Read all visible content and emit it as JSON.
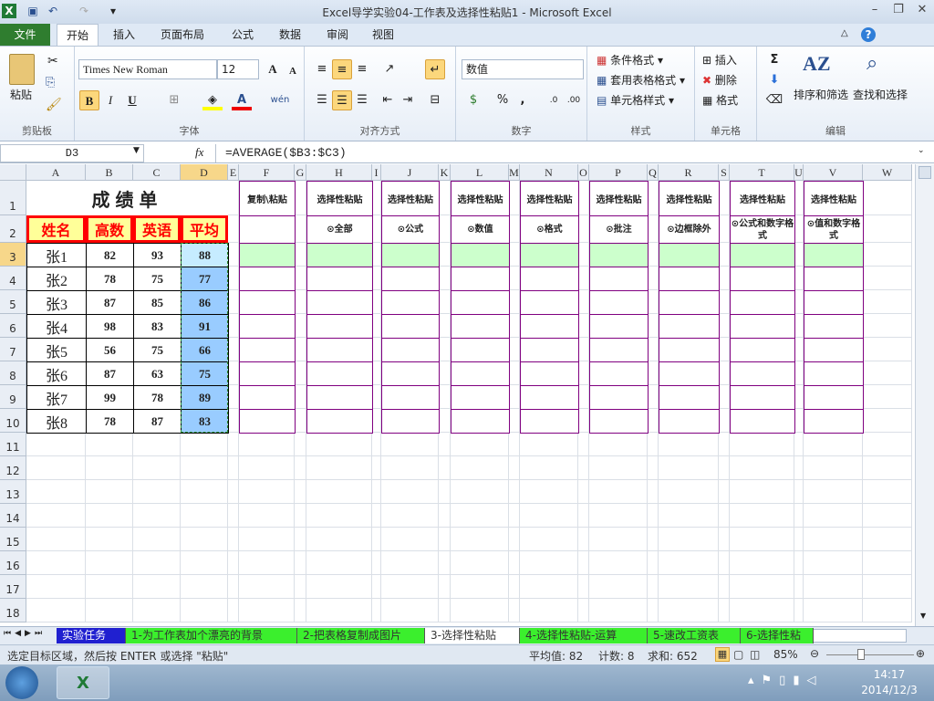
{
  "window": {
    "title": "Excel导学实验04-工作表及选择性粘贴1  -  Microsoft Excel"
  },
  "ribbon_tabs": [
    "文件",
    "开始",
    "插入",
    "页面布局",
    "公式",
    "数据",
    "审阅",
    "视图"
  ],
  "ribbon": {
    "clipboard": {
      "paste": "粘贴",
      "label": "剪贴板"
    },
    "font": {
      "name": "Times New Roman",
      "size": "12",
      "label": "字体",
      "bold": "B",
      "italic": "I",
      "underline": "U",
      "grow": "A",
      "shrink": "A",
      "phonetic": "wén"
    },
    "alignment": {
      "label": "对齐方式"
    },
    "number": {
      "format": "数值",
      "label": "数字",
      "percent": "%",
      "comma": ","
    },
    "styles": {
      "conditional": "条件格式",
      "table": "套用表格格式",
      "cell": "单元格样式",
      "label": "样式"
    },
    "cells": {
      "insert": "插入",
      "delete": "删除",
      "format": "格式",
      "label": "单元格"
    },
    "editing": {
      "sum": "Σ",
      "sort": "排序和筛选",
      "find": "查找和选择",
      "label": "编辑"
    }
  },
  "formula_bar": {
    "name_box": "D3",
    "fx": "fx",
    "formula": "=AVERAGE($B3:$C3)"
  },
  "columns": [
    "A",
    "B",
    "C",
    "D",
    "E",
    "F",
    "G",
    "H",
    "I",
    "J",
    "K",
    "L",
    "M",
    "N",
    "O",
    "P",
    "Q",
    "R",
    "S",
    "T",
    "U",
    "V",
    "W"
  ],
  "rows": [
    "1",
    "2",
    "3",
    "4",
    "5",
    "6",
    "7",
    "8",
    "9",
    "10",
    "11",
    "12",
    "13",
    "14",
    "15",
    "16",
    "17",
    "18"
  ],
  "score_table": {
    "title": "成绩单",
    "headers": [
      "姓名",
      "高数",
      "英语",
      "平均"
    ],
    "records": [
      [
        "张1",
        "82",
        "93",
        "88"
      ],
      [
        "张2",
        "78",
        "75",
        "77"
      ],
      [
        "张3",
        "87",
        "85",
        "86"
      ],
      [
        "张4",
        "98",
        "83",
        "91"
      ],
      [
        "张5",
        "56",
        "75",
        "66"
      ],
      [
        "张6",
        "87",
        "63",
        "75"
      ],
      [
        "张7",
        "99",
        "78",
        "89"
      ],
      [
        "张8",
        "78",
        "87",
        "83"
      ]
    ]
  },
  "paste_table": {
    "headers": [
      "复制\\粘贴",
      "选择性粘贴",
      "选择性粘贴",
      "选择性粘贴",
      "选择性粘贴",
      "选择性粘贴",
      "选择性粘贴",
      "选择性粘贴",
      "选择性粘贴"
    ],
    "options": [
      "",
      "⊙全部",
      "⊙公式",
      "⊙数值",
      "⊙格式",
      "⊙批注",
      "⊙边框除外",
      "⊙公式和数字格式",
      "⊙值和数字格式"
    ]
  },
  "sheet_tabs": [
    "实验任务",
    "1-为工作表加个漂亮的背景",
    "2-把表格复制成图片",
    "3-选择性粘贴",
    "4-选择性粘贴-运算",
    "5-速改工资表",
    "6-选择性粘"
  ],
  "status": {
    "message": "选定目标区域，然后按 ENTER 或选择 \"粘贴\"",
    "average": "平均值: 82",
    "count": "计数: 8",
    "sum": "求和: 652",
    "zoom": "85%"
  },
  "taskbar": {
    "time": "14:17",
    "date": "2014/12/3"
  },
  "colors": {
    "header_fill": "#ffff99",
    "header_text": "#ff0000",
    "avg_fill": "#99ccff",
    "paste_green": "#ccffcc",
    "purple_border": "#800080",
    "file_tab": "#2f7d2f"
  }
}
